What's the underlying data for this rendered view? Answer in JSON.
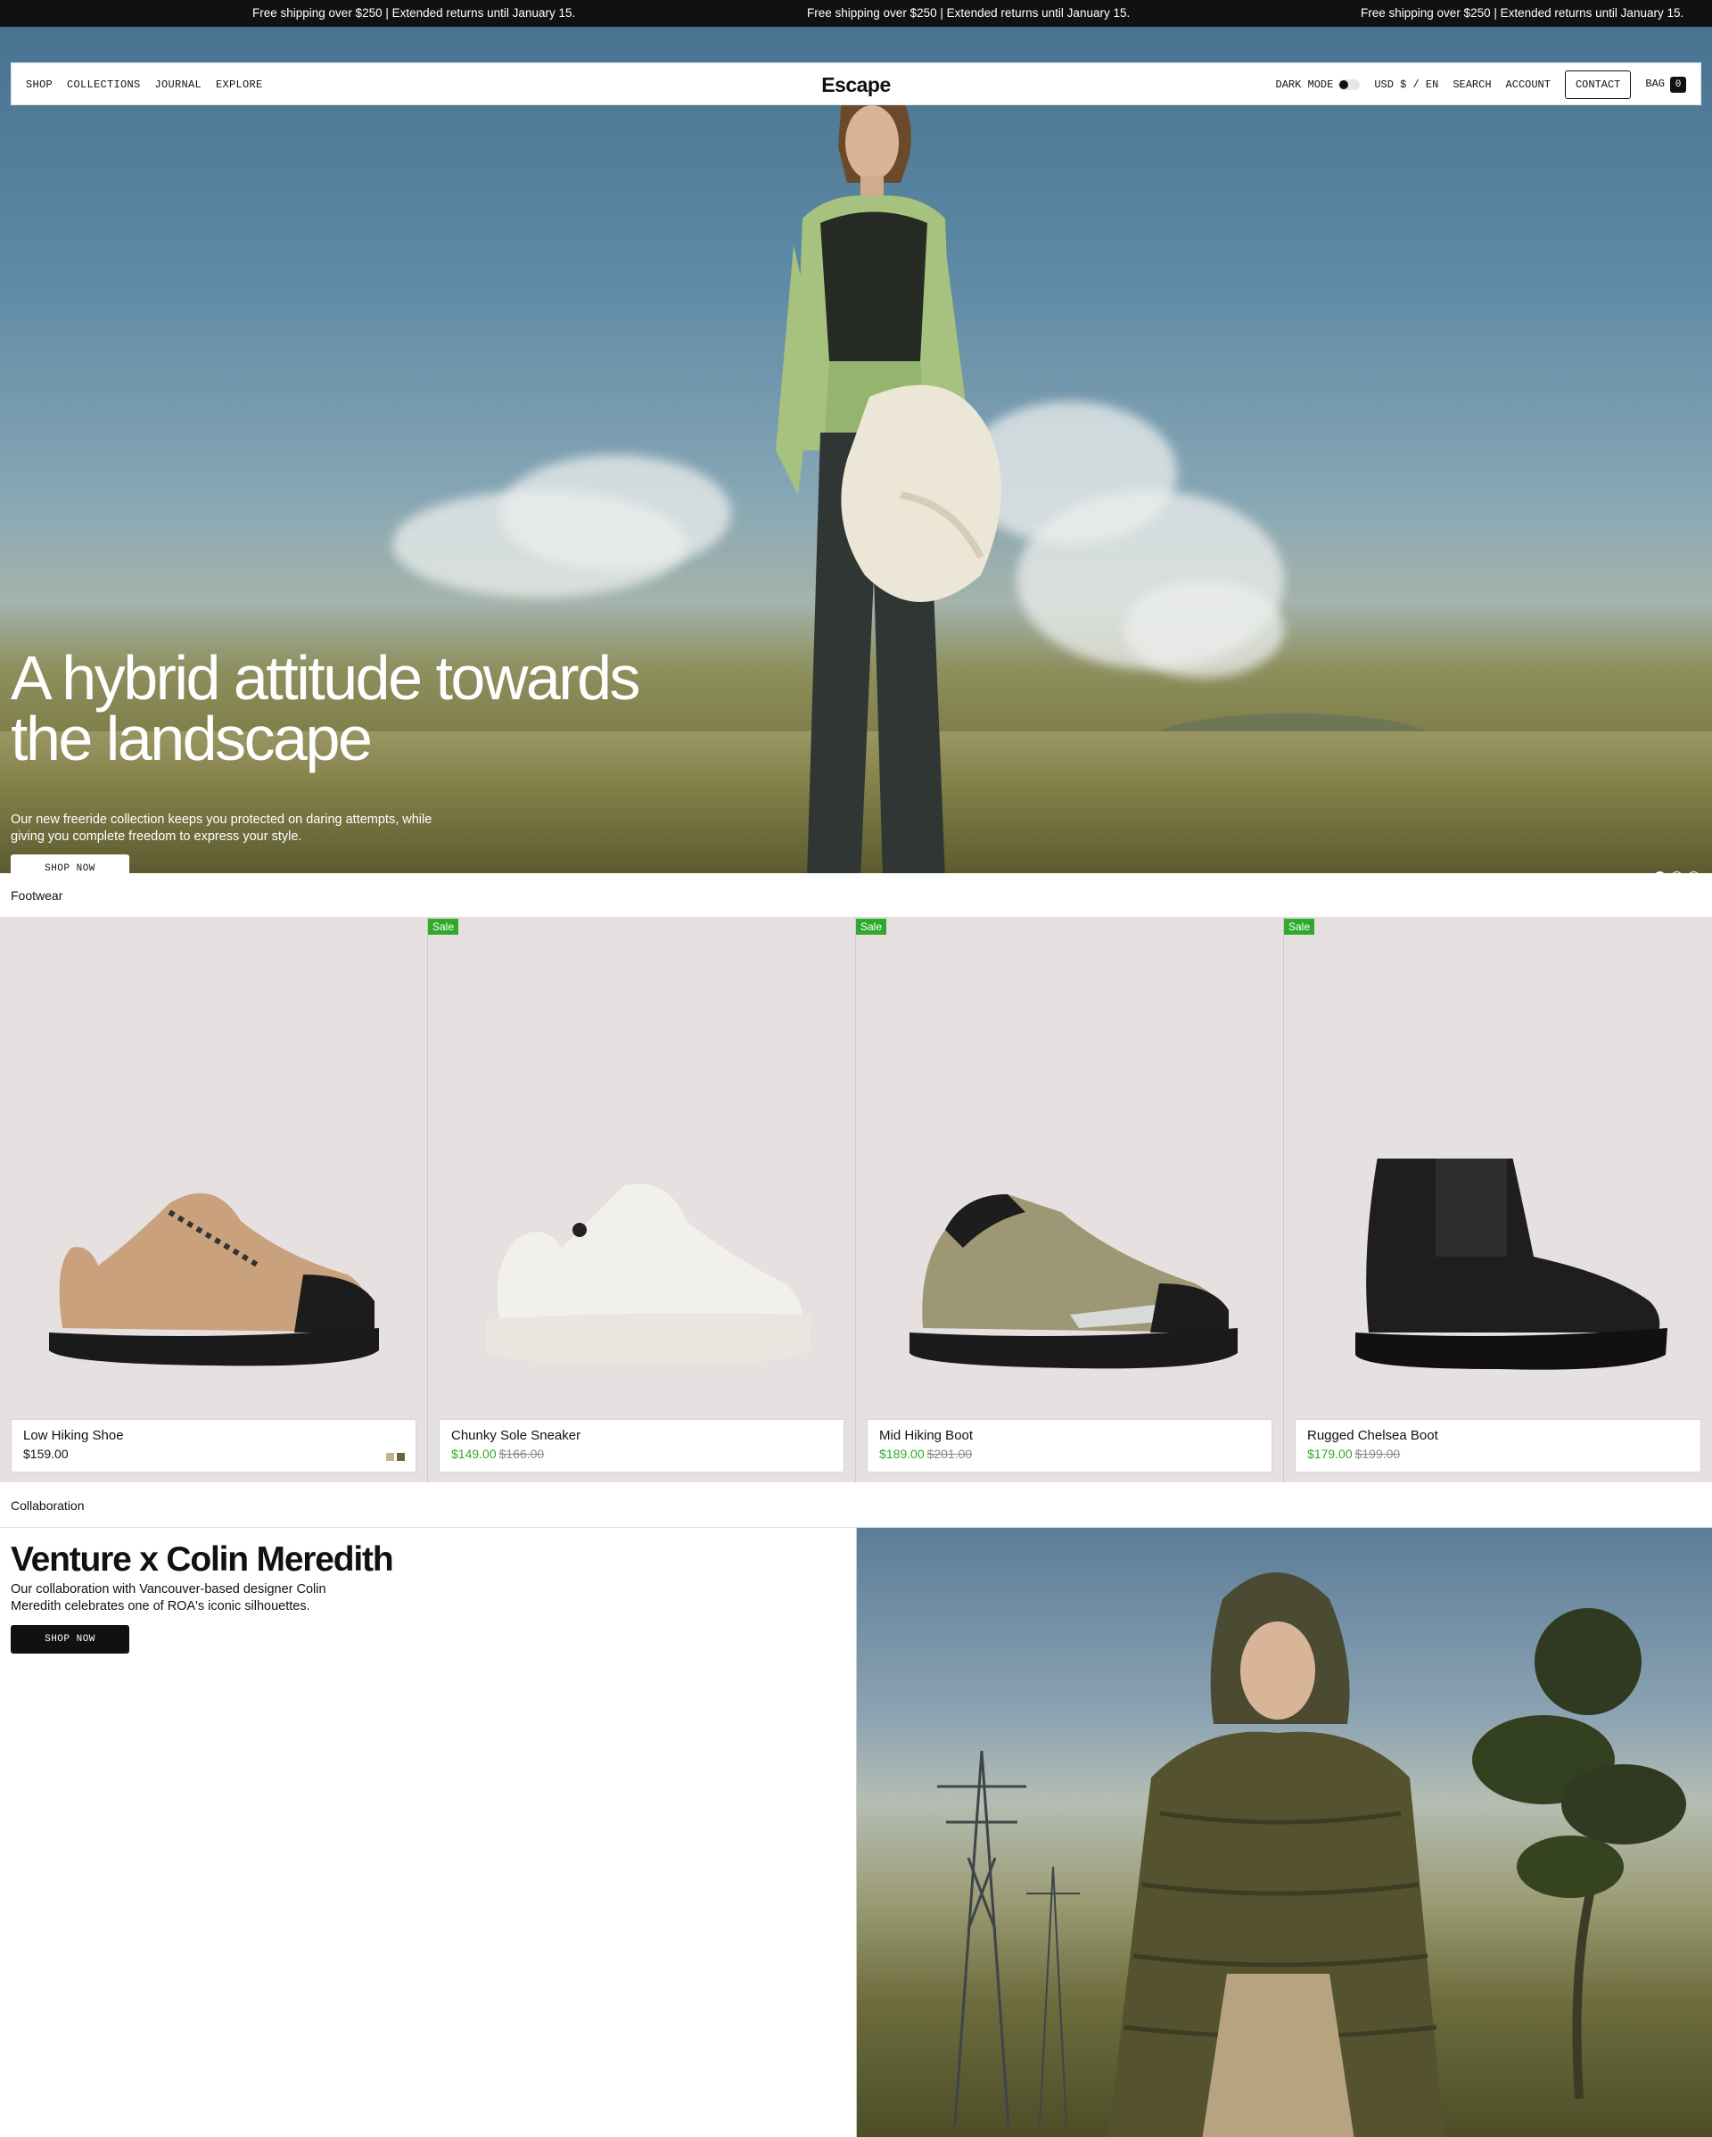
{
  "announcement": {
    "message": "Free shipping over $250 | Extended returns until January 15."
  },
  "header": {
    "nav_left": [
      "SHOP",
      "COLLECTIONS",
      "JOURNAL",
      "EXPLORE"
    ],
    "logo": "Escape",
    "dark_mode_label": "DARK MODE",
    "dark_mode_on": false,
    "locale": "USD $ / EN",
    "search": "SEARCH",
    "account": "ACCOUNT",
    "contact": "CONTACT",
    "bag": "BAG",
    "bag_count": "0"
  },
  "hero": {
    "title": "A hybrid attitude towards the landscape",
    "subtitle": "Our new freeride collection keeps you protected on daring attempts, while giving you complete freedom to express your style.",
    "cta": "SHOP NOW",
    "slides": 3,
    "active_slide": 1
  },
  "footwear": {
    "label": "Footwear",
    "products": [
      {
        "name": "Low Hiking Shoe",
        "price": "$159.00",
        "sale": false,
        "sale_price": "",
        "original_price": "",
        "swatches": [
          "#c7b08f",
          "#5f6a3c"
        ]
      },
      {
        "name": "Chunky Sole Sneaker",
        "price": "",
        "sale": true,
        "sale_price": "$149.00",
        "original_price": "$166.00",
        "swatches": []
      },
      {
        "name": "Mid Hiking Boot",
        "price": "",
        "sale": true,
        "sale_price": "$189.00",
        "original_price": "$201.00",
        "swatches": []
      },
      {
        "name": "Rugged Chelsea Boot",
        "price": "",
        "sale": true,
        "sale_price": "$179.00",
        "original_price": "$199.00",
        "swatches": []
      }
    ],
    "sale_badge": "Sale"
  },
  "collaboration": {
    "label": "Collaboration",
    "title": "Venture x Colin Meredith",
    "text": "Our collaboration with Vancouver-based designer Colin Meredith celebrates one of ROA's iconic silhouettes.",
    "cta": "SHOP NOW"
  },
  "colors": {
    "sale_green": "#2faa2d",
    "ink": "#111111",
    "product_bg": "#e6e0e0"
  }
}
